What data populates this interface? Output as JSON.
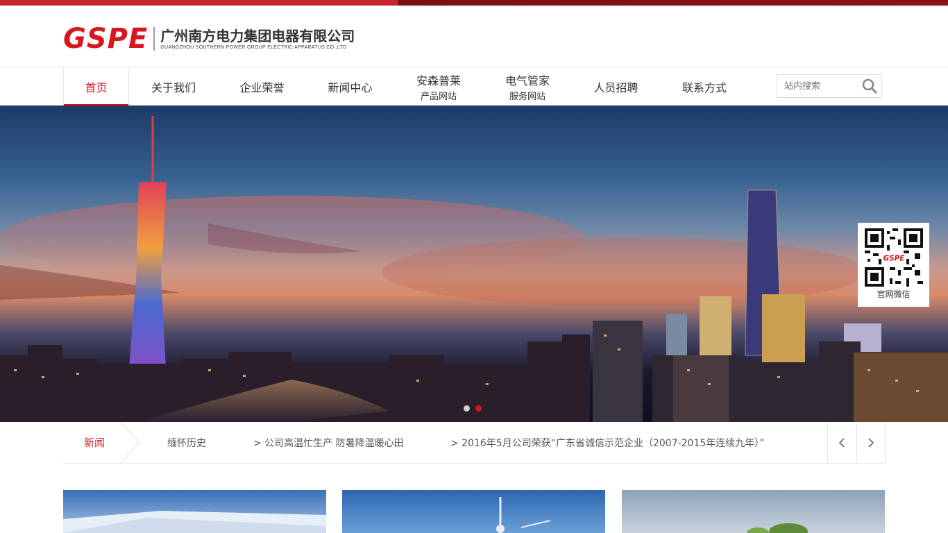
{
  "colors": {
    "accent": "#d7161e",
    "topbar": "#c8242c",
    "text": "#333333",
    "border": "#e6e6e6"
  },
  "header": {
    "logo_mark": "GSPE",
    "company_name": "广州南方电力集团电器有限公司",
    "company_name_en": "GUANGZHOU SOUTHERN POWER GROUP ELECTRIC APPARATUS CO.,LTD"
  },
  "nav": {
    "items": [
      {
        "label": "首页",
        "active": true
      },
      {
        "label": "关于我们"
      },
      {
        "label": "企业荣誉"
      },
      {
        "label": "新闻中心"
      },
      {
        "label": "安森普莱",
        "sub": "产品网站"
      },
      {
        "label": "电气管家",
        "sub": "服务网站"
      },
      {
        "label": "人员招聘"
      },
      {
        "label": "联系方式"
      }
    ],
    "search": {
      "placeholder": "站内搜索",
      "icon": "search-icon"
    }
  },
  "banner": {
    "qr_label": "官网微信",
    "qr_logo": "GSPE",
    "slides_count": 2,
    "active_slide": 2
  },
  "news": {
    "title": "新闻",
    "items": [
      "缅怀历史",
      "> 公司高温忙生产 防暑降温暖心田",
      "> 2016年5月公司荣获“广东省诚信示范企业（2007-2015年连续九年）”"
    ],
    "prev_icon": "chevron-left-icon",
    "next_icon": "chevron-right-icon"
  }
}
